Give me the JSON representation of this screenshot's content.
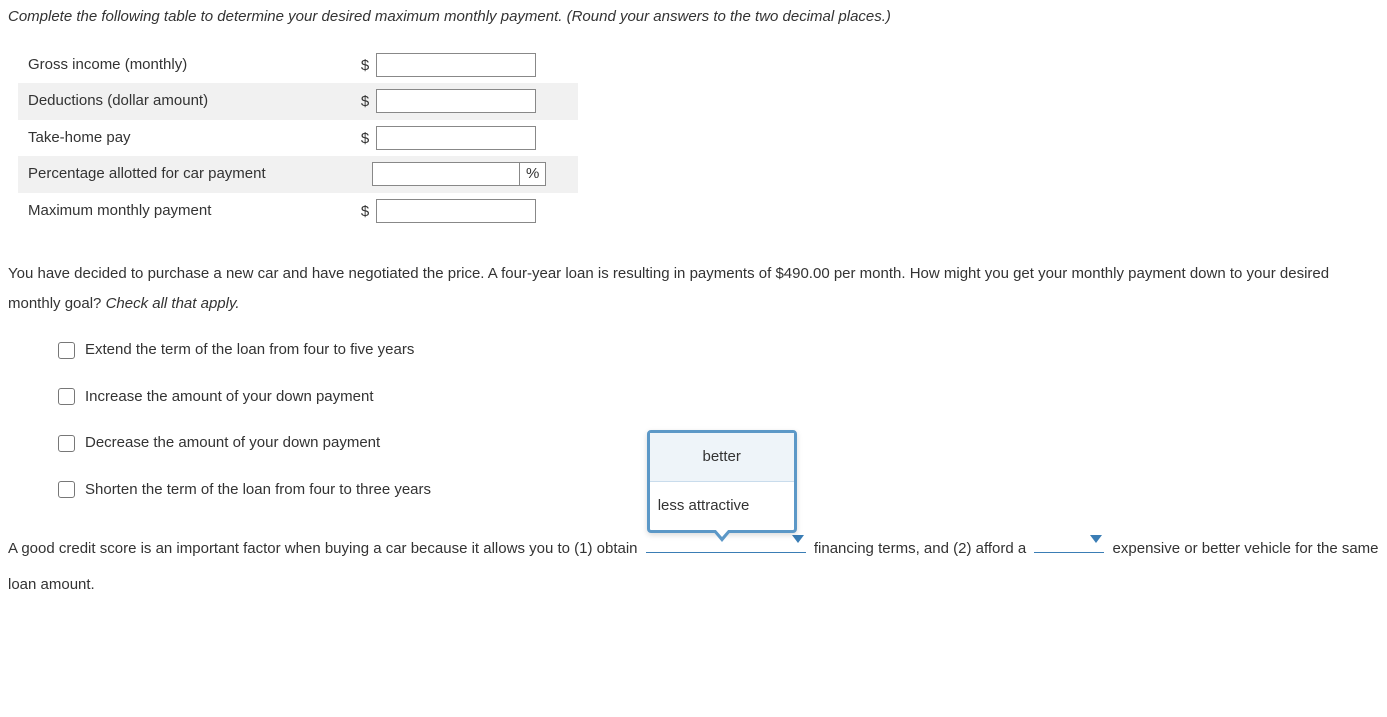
{
  "instruction": "Complete the following table to determine your desired maximum monthly payment. (Round your answers to the two decimal places.)",
  "table": {
    "rows": [
      {
        "label": "Gross income (monthly)",
        "prefix": "$",
        "suffix": "",
        "value": ""
      },
      {
        "label": "Deductions (dollar amount)",
        "prefix": "$",
        "suffix": "",
        "value": ""
      },
      {
        "label": "Take-home pay",
        "prefix": "$",
        "suffix": "",
        "value": ""
      },
      {
        "label": "Percentage allotted for car payment",
        "prefix": "",
        "suffix": "%",
        "value": ""
      },
      {
        "label": "Maximum monthly payment",
        "prefix": "$",
        "suffix": "",
        "value": ""
      }
    ]
  },
  "paragraph2_a": "You have decided to purchase a new car and have negotiated the price. A four-year loan is resulting in payments of $490.00 per month. How might you get your monthly payment down to your desired monthly goal? ",
  "paragraph2_b": "Check all that apply.",
  "checkboxes": [
    "Extend the term of the loan from four to five years",
    "Increase the amount of your down payment",
    "Decrease the amount of your down payment",
    "Shorten the term of the loan from four to three years"
  ],
  "bottom": {
    "part1": "A good credit score is an important factor when buying a car because it allows you to (1) obtain",
    "part2": "financing terms, and (2) afford a",
    "part3": "expensive or better vehicle for the same loan amount."
  },
  "dropdown1": {
    "options": [
      "better",
      "less attractive"
    ],
    "selected": ""
  },
  "dropdown2": {
    "selected": ""
  }
}
